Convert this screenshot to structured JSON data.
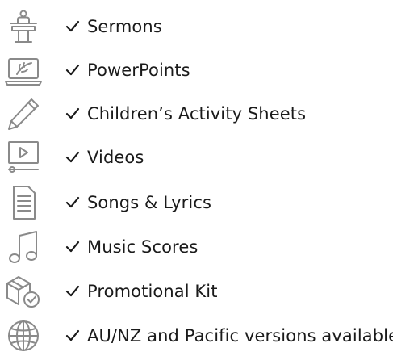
{
  "accent_color": "#1a1a1a",
  "icon_color": "#8a8a8a",
  "items": [
    {
      "icon": "pulpit-icon",
      "label": "Sermons"
    },
    {
      "icon": "laptop-leaf-icon",
      "label": "PowerPoints"
    },
    {
      "icon": "pencil-icon",
      "label": "Children’s Activity Sheets"
    },
    {
      "icon": "video-player-icon",
      "label": "Videos"
    },
    {
      "icon": "document-icon",
      "label": "Songs & Lyrics"
    },
    {
      "icon": "music-note-icon",
      "label": "Music Scores"
    },
    {
      "icon": "box-check-icon",
      "label": "Promotional Kit"
    },
    {
      "icon": "globe-icon",
      "label": "AU/NZ and Pacific versions available"
    }
  ]
}
